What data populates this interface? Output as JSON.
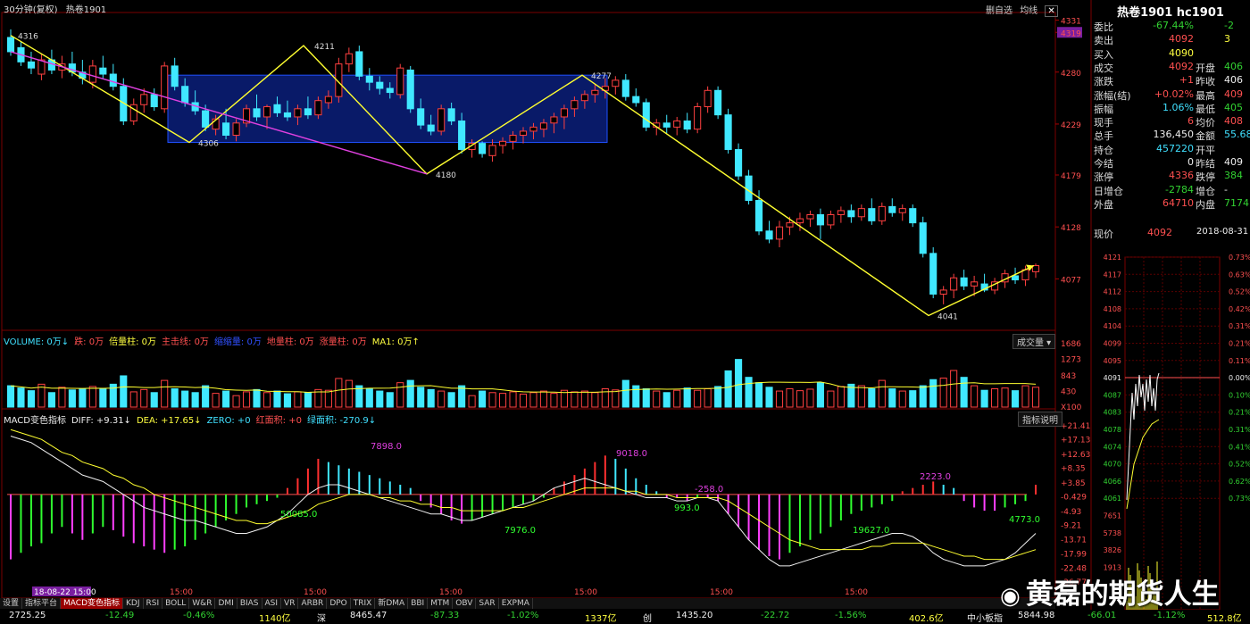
{
  "header": {
    "period": "30分钟(复权)",
    "symbol": "热卷1901"
  },
  "top_buttons": [
    "删自选",
    "均线",
    "✕"
  ],
  "price_axis": {
    "labels": [
      "4331",
      "4319",
      "4280",
      "4229",
      "4179",
      "4128",
      "4077"
    ]
  },
  "volume_axis": {
    "labels": [
      "1686",
      "1273",
      "843",
      "430",
      "X100"
    ]
  },
  "macd_axis": {
    "labels": [
      "+21.41",
      "+17.13",
      "+12.63",
      "+8.35",
      "+3.85",
      "-0.429",
      "-4.93",
      "-9.21",
      "-13.71",
      "-17.99",
      "-22.48",
      "-26.77"
    ]
  },
  "volume_legend": [
    {
      "text": "VOLUME: 0万↓",
      "color": "#40e0ff"
    },
    {
      "text": "跌: 0万",
      "color": "#ff5050"
    },
    {
      "text": "倍量柱: 0万",
      "color": "#ffff40"
    },
    {
      "text": "主击线: 0万",
      "color": "#ff5050"
    },
    {
      "text": "缩缩量: 0万",
      "color": "#3050ff"
    },
    {
      "text": "地量柱: 0万",
      "color": "#ff5050"
    },
    {
      "text": "涨量柱: 0万",
      "color": "#ff5050"
    },
    {
      "text": "MA1: 0万↑",
      "color": "#ffff40"
    }
  ],
  "volume_button": "成交量",
  "macd_legend": [
    {
      "text": "MACD变色指标",
      "color": "#eee"
    },
    {
      "text": "DIFF: +9.31↓",
      "color": "#eee"
    },
    {
      "text": "DEA: +17.65↓",
      "color": "#ffff40"
    },
    {
      "text": "ZERO: +0",
      "color": "#40e0ff"
    },
    {
      "text": "红面积: +0",
      "color": "#ff5050"
    },
    {
      "text": "绿面积: -270.9↓",
      "color": "#40e0ff"
    }
  ],
  "macd_button": "指标说明",
  "tabs": [
    "设置",
    "指标平台",
    "MACD变色指标",
    "KDJ",
    "RSI",
    "BOLL",
    "W&R",
    "DMI",
    "BIAS",
    "ASI",
    "VR",
    "ARBR",
    "DPO",
    "TRIX",
    "新DMA",
    "BBI",
    "MTM",
    "OBV",
    "SAR",
    "EXPMA"
  ],
  "status": [
    {
      "text": "2725.25",
      "color": "#eee",
      "x": 10
    },
    {
      "text": "-12.49",
      "color": "#32d232",
      "x": 118
    },
    {
      "text": "-0.46%",
      "color": "#32d232",
      "x": 205
    },
    {
      "text": "1140亿",
      "color": "#ffff40",
      "x": 290
    },
    {
      "text": "深",
      "color": "#eee",
      "x": 355
    },
    {
      "text": "8465.47",
      "color": "#eee",
      "x": 392
    },
    {
      "text": "-87.33",
      "color": "#32d232",
      "x": 482
    },
    {
      "text": "-1.02%",
      "color": "#32d232",
      "x": 568
    },
    {
      "text": "1337亿",
      "color": "#ffff40",
      "x": 655
    },
    {
      "text": "创",
      "color": "#eee",
      "x": 720
    },
    {
      "text": "1435.20",
      "color": "#eee",
      "x": 757
    },
    {
      "text": "-22.72",
      "color": "#32d232",
      "x": 852
    },
    {
      "text": "-1.56%",
      "color": "#32d232",
      "x": 935
    },
    {
      "text": "402.6亿",
      "color": "#ffff40",
      "x": 1018
    },
    {
      "text": "中小板指",
      "color": "#eee",
      "x": 1083
    },
    {
      "text": "5844.98",
      "color": "#eee",
      "x": 1140
    },
    {
      "text": "-66.01",
      "color": "#32d232",
      "x": 1218
    },
    {
      "text": "-1.12%",
      "color": "#32d232",
      "x": 1292
    },
    {
      "text": "512.8亿",
      "color": "#ffff40",
      "x": 1352
    }
  ],
  "brand": {
    "logo": "◉",
    "text": "黄磊的期货人生"
  },
  "side": {
    "title": "热卷1901 hc1901",
    "rows": [
      {
        "l": "委比",
        "v": "-67.44%",
        "vc": "#32d232",
        "l2": "",
        "v2": "-2",
        "v2c": "#32d232"
      },
      {
        "l": "卖出",
        "v": "4092",
        "vc": "#ff5050",
        "l2": "",
        "v2": "3",
        "v2c": "#ffff40"
      },
      {
        "l": "买入",
        "v": "4090",
        "vc": "#ffff40",
        "l2": "",
        "v2": "",
        "v2c": "#eee"
      },
      {
        "l": "成交",
        "v": "4092",
        "vc": "#ff5050",
        "l2": "开盘",
        "v2": "406",
        "v2c": "#32d232"
      },
      {
        "l": "涨跌",
        "v": "+1",
        "vc": "#ff5050",
        "l2": "昨收",
        "v2": "406",
        "v2c": "#eee"
      },
      {
        "l": "涨幅(结)",
        "v": "+0.02%",
        "vc": "#ff5050",
        "l2": "最高",
        "v2": "409",
        "v2c": "#ff5050"
      },
      {
        "l": "振幅",
        "v": "1.06%",
        "vc": "#40e0ff",
        "l2": "最低",
        "v2": "405",
        "v2c": "#32d232"
      },
      {
        "l": "现手",
        "v": "6",
        "vc": "#ff5050",
        "l2": "均价",
        "v2": "408",
        "v2c": "#ff5050"
      },
      {
        "l": "总手",
        "v": "136,450",
        "vc": "#eee",
        "l2": "金额",
        "v2": "55.68",
        "v2c": "#40e0ff"
      },
      {
        "l": "持仓",
        "v": "457220",
        "vc": "#40e0ff",
        "l2": "开平",
        "v2": "",
        "v2c": "#eee"
      },
      {
        "l": "今结",
        "v": "0",
        "vc": "#eee",
        "l2": "昨结",
        "v2": "409",
        "v2c": "#eee"
      },
      {
        "l": "涨停",
        "v": "4336",
        "vc": "#ff5050",
        "l2": "跌停",
        "v2": "384",
        "v2c": "#32d232"
      },
      {
        "l": "日增仓",
        "v": "-2784",
        "vc": "#32d232",
        "l2": "增仓",
        "v2": "-",
        "v2c": "#eee"
      },
      {
        "l": "外盘",
        "v": "64710",
        "vc": "#ff5050",
        "l2": "内盘",
        "v2": "7174",
        "v2c": "#32d232"
      }
    ],
    "price_row": {
      "label": "现价",
      "value": "4092",
      "date": "2018-08-31"
    },
    "mini_left": [
      "4121",
      "4117",
      "4112",
      "4108",
      "4104",
      "4099",
      "4095",
      "4091",
      "4087",
      "4083",
      "4078",
      "4074",
      "4070",
      "4066",
      "4061",
      "7651",
      "5738",
      "3826",
      "1913"
    ],
    "mini_right": [
      "0.73%",
      "0.63%",
      "0.52%",
      "0.42%",
      "0.31%",
      "0.21%",
      "0.11%",
      "0.00%",
      "0.10%",
      "0.21%",
      "0.31%",
      "0.41%",
      "0.52%",
      "0.62%",
      "0.73%"
    ]
  },
  "chart_data": {
    "type": "candlestick",
    "instrument": "热卷1901",
    "ohlc": [
      [
        4314,
        4322,
        4296,
        4300
      ],
      [
        4304,
        4310,
        4286,
        4290
      ],
      [
        4290,
        4300,
        4278,
        4284
      ],
      [
        4278,
        4298,
        4272,
        4292
      ],
      [
        4292,
        4302,
        4278,
        4282
      ],
      [
        4282,
        4296,
        4274,
        4288
      ],
      [
        4288,
        4300,
        4276,
        4280
      ],
      [
        4280,
        4292,
        4268,
        4274
      ],
      [
        4270,
        4292,
        4264,
        4286
      ],
      [
        4284,
        4296,
        4274,
        4278
      ],
      [
        4278,
        4288,
        4262,
        4266
      ],
      [
        4266,
        4274,
        4228,
        4232
      ],
      [
        4232,
        4254,
        4228,
        4248
      ],
      [
        4248,
        4264,
        4240,
        4258
      ],
      [
        4258,
        4264,
        4242,
        4246
      ],
      [
        4244,
        4290,
        4240,
        4286
      ],
      [
        4286,
        4294,
        4262,
        4266
      ],
      [
        4266,
        4274,
        4246,
        4250
      ],
      [
        4250,
        4262,
        4238,
        4242
      ],
      [
        4242,
        4248,
        4222,
        4226
      ],
      [
        4224,
        4238,
        4218,
        4234
      ],
      [
        4230,
        4244,
        4214,
        4218
      ],
      [
        4218,
        4234,
        4212,
        4230
      ],
      [
        4230,
        4248,
        4226,
        4244
      ],
      [
        4244,
        4258,
        4232,
        4236
      ],
      [
        4236,
        4248,
        4224,
        4246
      ],
      [
        4248,
        4256,
        4236,
        4240
      ],
      [
        4240,
        4252,
        4232,
        4236
      ],
      [
        4236,
        4248,
        4228,
        4244
      ],
      [
        4244,
        4256,
        4234,
        4238
      ],
      [
        4238,
        4256,
        4234,
        4252
      ],
      [
        4250,
        4262,
        4244,
        4256
      ],
      [
        4256,
        4294,
        4250,
        4288
      ],
      [
        4288,
        4304,
        4280,
        4298
      ],
      [
        4300,
        4306,
        4272,
        4276
      ],
      [
        4276,
        4284,
        4262,
        4270
      ],
      [
        4270,
        4276,
        4258,
        4264
      ],
      [
        4264,
        4270,
        4254,
        4260
      ],
      [
        4258,
        4288,
        4254,
        4284
      ],
      [
        4282,
        4286,
        4240,
        4244
      ],
      [
        4244,
        4254,
        4224,
        4228
      ],
      [
        4228,
        4238,
        4218,
        4222
      ],
      [
        4222,
        4248,
        4218,
        4244
      ],
      [
        4244,
        4250,
        4228,
        4232
      ],
      [
        4232,
        4240,
        4200,
        4204
      ],
      [
        4204,
        4214,
        4196,
        4210
      ],
      [
        4210,
        4212,
        4196,
        4200
      ],
      [
        4198,
        4214,
        4192,
        4208
      ],
      [
        4208,
        4216,
        4200,
        4212
      ],
      [
        4212,
        4222,
        4204,
        4218
      ],
      [
        4218,
        4226,
        4210,
        4222
      ],
      [
        4222,
        4230,
        4214,
        4226
      ],
      [
        4224,
        4234,
        4216,
        4230
      ],
      [
        4230,
        4240,
        4220,
        4236
      ],
      [
        4236,
        4248,
        4224,
        4244
      ],
      [
        4244,
        4256,
        4236,
        4252
      ],
      [
        4252,
        4262,
        4244,
        4258
      ],
      [
        4258,
        4268,
        4250,
        4262
      ],
      [
        4262,
        4274,
        4254,
        4266
      ],
      [
        4266,
        4276,
        4258,
        4272
      ],
      [
        4272,
        4278,
        4252,
        4256
      ],
      [
        4256,
        4264,
        4246,
        4250
      ],
      [
        4250,
        4254,
        4222,
        4226
      ],
      [
        4226,
        4234,
        4218,
        4230
      ],
      [
        4230,
        4238,
        4220,
        4226
      ],
      [
        4226,
        4236,
        4218,
        4232
      ],
      [
        4232,
        4240,
        4220,
        4224
      ],
      [
        4224,
        4250,
        4220,
        4246
      ],
      [
        4246,
        4266,
        4240,
        4262
      ],
      [
        4262,
        4266,
        4234,
        4238
      ],
      [
        4238,
        4244,
        4200,
        4204
      ],
      [
        4204,
        4210,
        4174,
        4178
      ],
      [
        4178,
        4184,
        4150,
        4154
      ],
      [
        4154,
        4164,
        4120,
        4124
      ],
      [
        4124,
        4134,
        4112,
        4116
      ],
      [
        4116,
        4134,
        4108,
        4128
      ],
      [
        4128,
        4138,
        4120,
        4132
      ],
      [
        4132,
        4142,
        4124,
        4136
      ],
      [
        4136,
        4144,
        4128,
        4140
      ],
      [
        4140,
        4146,
        4116,
        4130
      ],
      [
        4130,
        4144,
        4126,
        4140
      ],
      [
        4140,
        4148,
        4132,
        4144
      ],
      [
        4144,
        4150,
        4132,
        4138
      ],
      [
        4138,
        4150,
        4134,
        4146
      ],
      [
        4146,
        4156,
        4130,
        4134
      ],
      [
        4134,
        4152,
        4130,
        4148
      ],
      [
        4148,
        4156,
        4138,
        4142
      ],
      [
        4142,
        4150,
        4134,
        4146
      ],
      [
        4146,
        4150,
        4128,
        4132
      ],
      [
        4132,
        4138,
        4098,
        4102
      ],
      [
        4102,
        4108,
        4058,
        4062
      ],
      [
        4062,
        4070,
        4052,
        4066
      ],
      [
        4066,
        4082,
        4058,
        4078
      ],
      [
        4078,
        4086,
        4066,
        4070
      ],
      [
        4070,
        4080,
        4060,
        4074
      ],
      [
        4072,
        4082,
        4064,
        4066
      ],
      [
        4066,
        4078,
        4062,
        4074
      ],
      [
        4074,
        4086,
        4068,
        4082
      ],
      [
        4080,
        4088,
        4072,
        4076
      ],
      [
        4076,
        4090,
        4070,
        4086
      ],
      [
        4084,
        4092,
        4078,
        4090
      ]
    ],
    "volume": [
      560,
      500,
      430,
      600,
      380,
      520,
      450,
      470,
      540,
      480,
      600,
      820,
      400,
      460,
      380,
      700,
      480,
      420,
      380,
      560,
      360,
      420,
      300,
      400,
      460,
      380,
      420,
      350,
      400,
      380,
      460,
      440,
      750,
      700,
      560,
      480,
      420,
      380,
      640,
      700,
      520,
      460,
      420,
      380,
      560,
      300,
      420,
      380,
      360,
      400,
      340,
      380,
      420,
      360,
      440,
      400,
      420,
      380,
      480,
      450,
      700,
      560,
      480,
      420,
      380,
      440,
      500,
      440,
      480,
      540,
      950,
      1250,
      780,
      640,
      520,
      420,
      480,
      430,
      470,
      640,
      420,
      540,
      600,
      560,
      480,
      700,
      480,
      420,
      430,
      560,
      720,
      760,
      960,
      780,
      560,
      440,
      480,
      500,
      430,
      560,
      520
    ],
    "macd_hist": [
      -20,
      -18,
      -16,
      -15,
      -12,
      -10,
      -12,
      -14,
      -12,
      -10,
      -11,
      -13,
      -15,
      -16,
      -17,
      -18,
      -17,
      -16,
      -14,
      -12,
      -10,
      -8,
      -6,
      -4,
      -3,
      -2,
      -1,
      2,
      5,
      8,
      11,
      10,
      9,
      8,
      7,
      6,
      5,
      4,
      3,
      2,
      -2,
      -4,
      -6,
      -8,
      -9,
      -8,
      -7,
      -6,
      -5,
      -4,
      -3,
      -2,
      -1,
      2,
      4,
      6,
      8,
      10,
      12,
      11,
      8,
      5,
      3,
      1,
      -1,
      -1,
      -2,
      -1,
      -1,
      -2,
      -6,
      -10,
      -14,
      -17,
      -19,
      -20,
      -18,
      -16,
      -14,
      -12,
      -10,
      -8,
      -6,
      -5,
      -4,
      -3,
      -2,
      1,
      2,
      3,
      4,
      3,
      2,
      -2,
      -4,
      -5,
      -5,
      -4,
      -3,
      -2,
      3
    ],
    "diff": [
      18,
      17,
      16,
      14,
      12,
      10,
      8,
      6,
      5,
      4,
      2,
      0,
      -2,
      -4,
      -5,
      -6,
      -7,
      -8,
      -8,
      -9,
      -10,
      -11,
      -12,
      -12,
      -11,
      -10,
      -8,
      -6,
      -3,
      0,
      2,
      3,
      3,
      2,
      1,
      0,
      -1,
      -2,
      -3,
      -4,
      -5,
      -6,
      -6,
      -7,
      -8,
      -8,
      -7,
      -6,
      -5,
      -4,
      -3,
      -2,
      0,
      2,
      3,
      4,
      5,
      4,
      3,
      2,
      1,
      0,
      -1,
      -1,
      -1,
      -2,
      -2,
      -1,
      -1,
      -2,
      -6,
      -10,
      -14,
      -17,
      -20,
      -22,
      -22,
      -21,
      -20,
      -19,
      -18,
      -17,
      -16,
      -15,
      -14,
      -13,
      -12,
      -12,
      -13,
      -15,
      -18,
      -20,
      -21,
      -22,
      -22,
      -22,
      -21,
      -20,
      -18,
      -15,
      -12
    ],
    "dea": [
      20,
      19,
      18,
      17,
      15,
      13,
      12,
      10,
      9,
      8,
      6,
      5,
      3,
      2,
      0,
      -1,
      -2,
      -3,
      -4,
      -5,
      -6,
      -7,
      -8,
      -8,
      -9,
      -9,
      -8,
      -7,
      -6,
      -5,
      -3,
      -2,
      -1,
      0,
      0,
      0,
      -1,
      -1,
      -2,
      -2,
      -3,
      -3,
      -4,
      -4,
      -5,
      -5,
      -5,
      -5,
      -5,
      -4,
      -4,
      -3,
      -2,
      -1,
      0,
      1,
      2,
      2,
      2,
      2,
      1,
      1,
      0,
      0,
      0,
      -1,
      -1,
      -1,
      -1,
      -1,
      -2,
      -4,
      -6,
      -8,
      -10,
      -12,
      -14,
      -15,
      -16,
      -17,
      -17,
      -17,
      -17,
      -17,
      -16,
      -16,
      -15,
      -15,
      -15,
      -15,
      -16,
      -17,
      -18,
      -19,
      -19,
      -20,
      -20,
      -20,
      -19,
      -18,
      -17
    ],
    "price_annotations": [
      "4316",
      "4306",
      "4211",
      "4180",
      "4277",
      "4041"
    ],
    "macd_annotations": [
      "7898.0",
      "9018.0",
      "2223.0",
      "50085.0",
      "7976.0",
      "993.0",
      "-258.0",
      "19627.0",
      "4773.0"
    ],
    "x_labels": [
      "18-08-22 15:00",
      "15:00",
      "15:00",
      "15:00",
      "15:00",
      "15:00",
      "15:00"
    ],
    "ylim": [
      4030,
      4335
    ]
  }
}
